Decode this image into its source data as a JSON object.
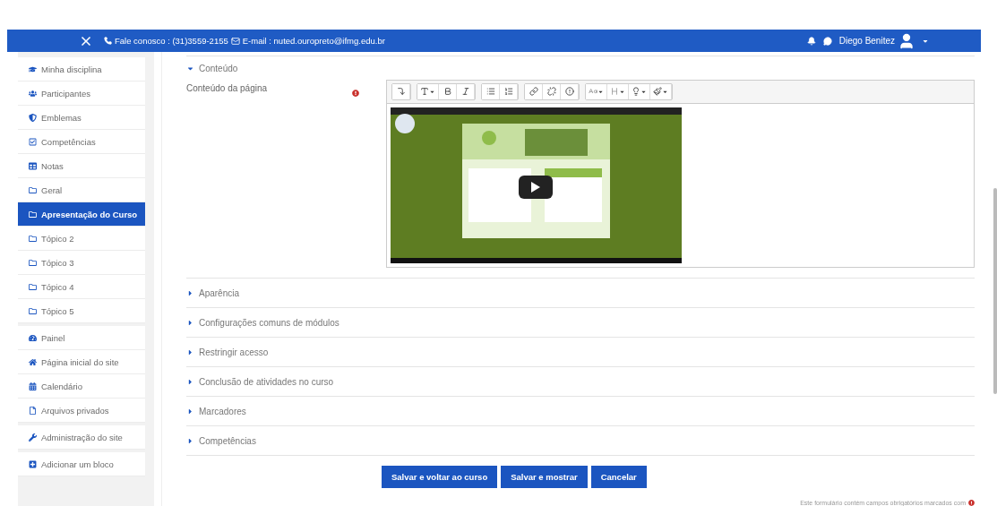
{
  "top_bar": {
    "contact": "Fale conosco : (31)3559-2155",
    "email": "E-mail : nuted.ouropreto@ifmg.edu.br",
    "user_name": "Diego Benitez"
  },
  "sidebar": {
    "blocks": [
      [
        {
          "label": "Minha disciplina",
          "selected": false
        },
        {
          "label": "Participantes",
          "selected": false
        },
        {
          "label": "Emblemas",
          "selected": false
        },
        {
          "label": "Competências",
          "selected": false
        },
        {
          "label": "Notas",
          "selected": false
        },
        {
          "label": "Geral",
          "selected": false
        },
        {
          "label": "Apresentação do Curso",
          "selected": true
        },
        {
          "label": "Tópico 2",
          "selected": false
        },
        {
          "label": "Tópico 3",
          "selected": false
        },
        {
          "label": "Tópico 4",
          "selected": false
        },
        {
          "label": "Tópico 5",
          "selected": false
        }
      ],
      [
        {
          "label": "Painel",
          "selected": false
        },
        {
          "label": "Página inicial do site",
          "selected": false
        },
        {
          "label": "Calendário",
          "selected": false
        },
        {
          "label": "Arquivos privados",
          "selected": false
        }
      ],
      [
        {
          "label": "Administração do site",
          "selected": false
        }
      ],
      [
        {
          "label": "Adicionar um bloco",
          "selected": false
        }
      ]
    ]
  },
  "form": {
    "content_section": {
      "title": "Conteúdo",
      "expanded": true,
      "field_label": "Conteúdo da página",
      "required": true
    },
    "sections": [
      {
        "title": "Aparência",
        "expanded": false
      },
      {
        "title": "Configurações comuns de módulos",
        "expanded": false
      },
      {
        "title": "Restringir acesso",
        "expanded": false
      },
      {
        "title": "Conclusão de atividades no curso",
        "expanded": false
      },
      {
        "title": "Marcadores",
        "expanded": false
      },
      {
        "title": "Competências",
        "expanded": false
      }
    ],
    "buttons": [
      "Salvar e voltar ao curso",
      "Salvar e mostrar",
      "Cancelar"
    ],
    "footnote": "Este formulário contém campos obrigatórios marcados com"
  }
}
